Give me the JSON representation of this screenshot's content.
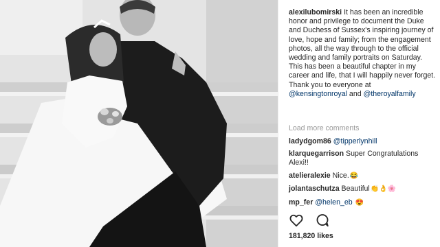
{
  "post": {
    "author": "alexilubomirski",
    "caption_text": "It has been an incredible honor and privilege to document the Duke and Duchess of Sussex's inspiring journey of love, hope and family; from the engagement photos, all the way through to the official wedding and family portraits on Saturday. This has been a beautiful chapter in my career and life, that I will happily never forget.",
    "thanks_line": "Thank you to everyone at",
    "mention_1": "@kensingtonroyal",
    "and_word": "and",
    "mention_2": "@theroyalfamily"
  },
  "load_more": "Load more comments",
  "comments": [
    {
      "user": "ladydgom86",
      "text": "",
      "mention": "@tipperlynhill",
      "emoji": ""
    },
    {
      "user": "klarquegarrison",
      "text": "Super Congratulations Alexi!!",
      "mention": "",
      "emoji": ""
    },
    {
      "user": "atelieralexie",
      "text": "Nice.",
      "mention": "",
      "emoji": "😂"
    },
    {
      "user": "jolantaschutza",
      "text": "Beautiful",
      "mention": "",
      "emoji": "👏👌🌸"
    },
    {
      "user": "mp_fer",
      "text": "",
      "mention": "@helen_eb",
      "emoji": "😍"
    }
  ],
  "actions": {
    "like_icon": "heart-outline-icon",
    "comment_icon": "comment-bubble-icon"
  },
  "likes": "181,820 likes",
  "colors": {
    "mention": "#003569",
    "muted": "#999999",
    "text": "#262626"
  }
}
